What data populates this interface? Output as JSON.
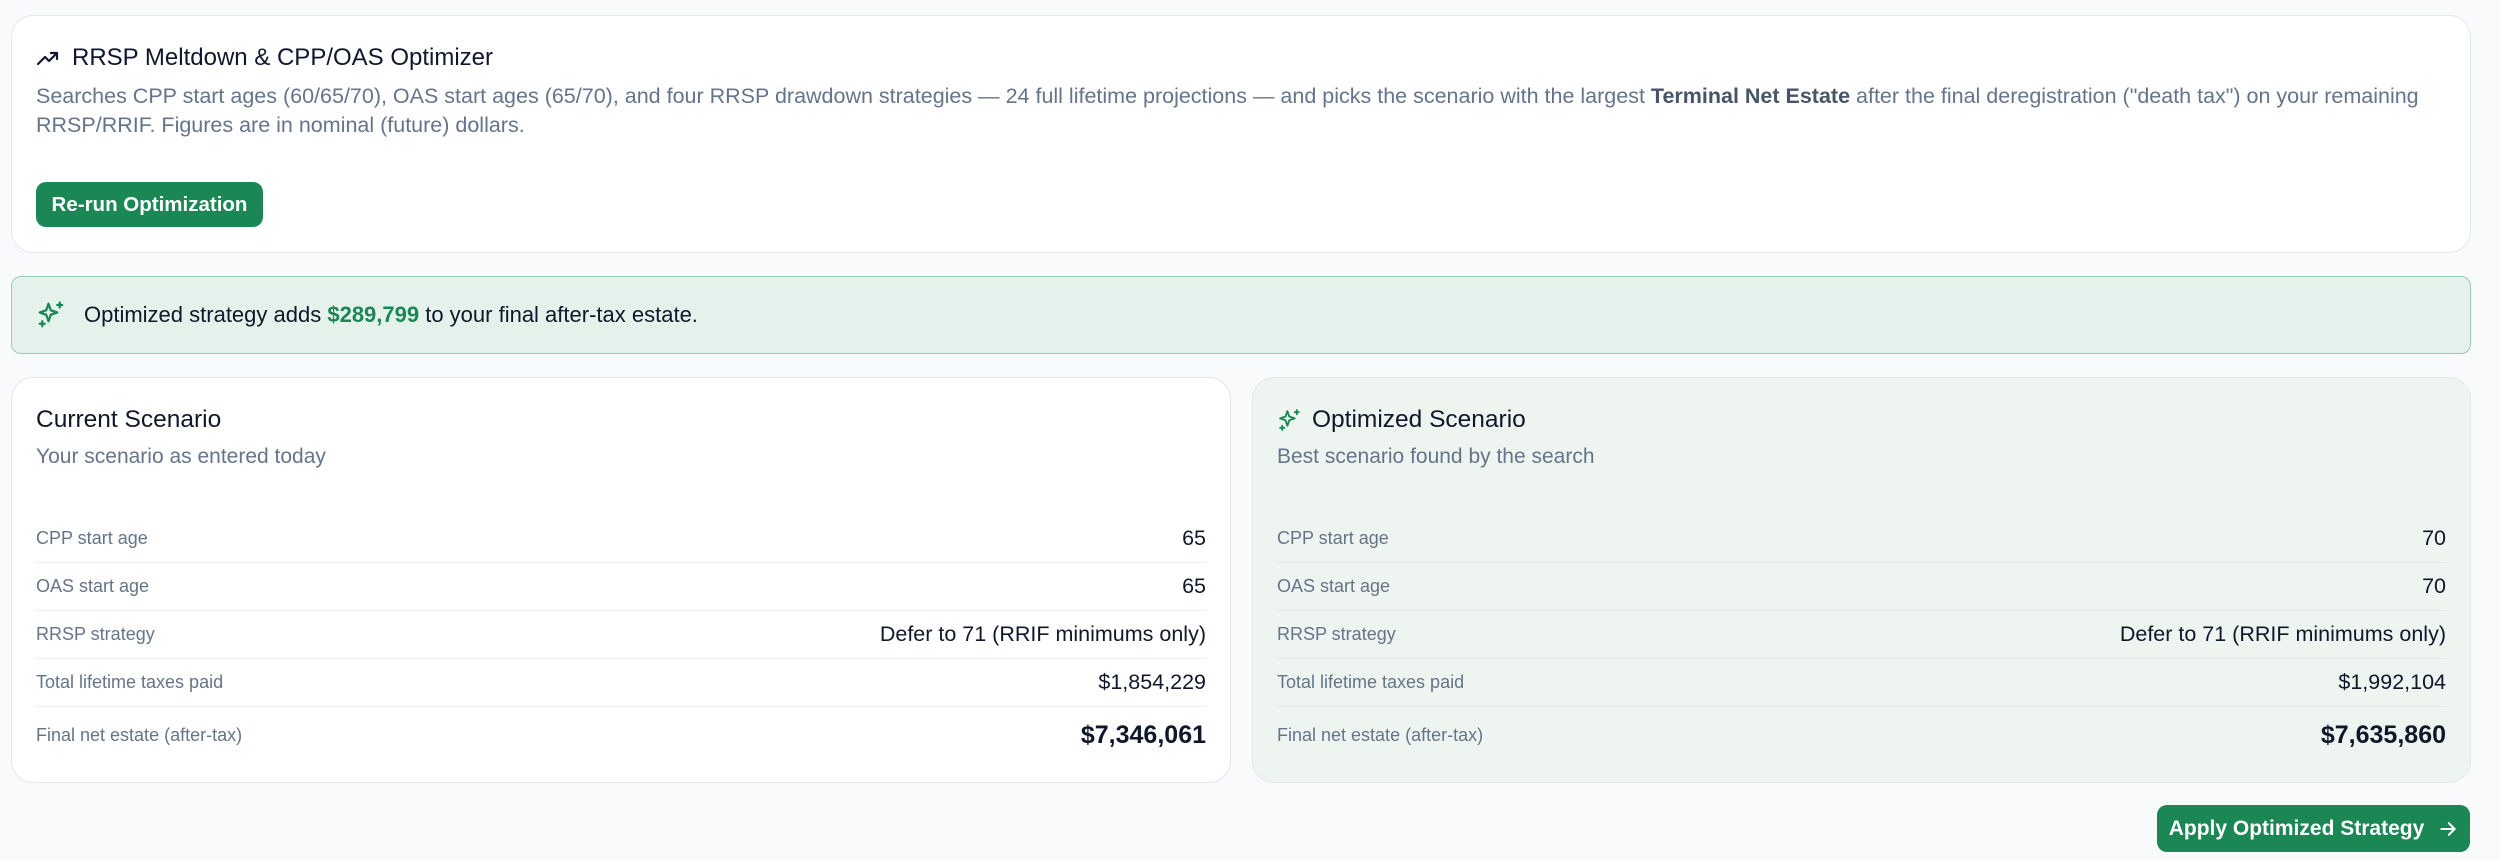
{
  "header": {
    "icon": "trending-up-icon",
    "title": "RRSP Meltdown & CPP/OAS Optimizer",
    "desc_before": "Searches CPP start ages (60/65/70), OAS start ages (65/70), and four RRSP drawdown strategies — 24 full lifetime projections — and picks the scenario with the largest ",
    "desc_bold": "Terminal Net Estate",
    "desc_after": " after the final deregistration (\"death tax\") on your remaining RRSP/RRIF. Figures are in nominal (future) dollars.",
    "rerun_label": "Re-run Optimization"
  },
  "banner": {
    "icon": "sparkles-icon",
    "text_before": "Optimized strategy adds ",
    "amount": "$289,799",
    "text_after": " to your final after-tax estate."
  },
  "current": {
    "title": "Current Scenario",
    "subtitle": "Your scenario as entered today",
    "rows": [
      {
        "label": "CPP start age",
        "value": "65"
      },
      {
        "label": "OAS start age",
        "value": "65"
      },
      {
        "label": "RRSP strategy",
        "value": "Defer to 71 (RRIF minimums only)"
      },
      {
        "label": "Total lifetime taxes paid",
        "value": "$1,854,229"
      },
      {
        "label": "Final net estate (after-tax)",
        "value": "$7,346,061"
      }
    ]
  },
  "optimized": {
    "icon": "sparkles-icon",
    "title": "Optimized Scenario",
    "subtitle": "Best scenario found by the search",
    "rows": [
      {
        "label": "CPP start age",
        "value": "70"
      },
      {
        "label": "OAS start age",
        "value": "70"
      },
      {
        "label": "RRSP strategy",
        "value": "Defer to 71 (RRIF minimums only)"
      },
      {
        "label": "Total lifetime taxes paid",
        "value": "$1,992,104"
      },
      {
        "label": "Final net estate (after-tax)",
        "value": "$7,635,860"
      }
    ]
  },
  "apply_label": "Apply Optimized Strategy",
  "colors": {
    "accent": "#1a8754",
    "banner_bg": "#e5f2ec",
    "optimized_bg": "#eef5f1"
  }
}
